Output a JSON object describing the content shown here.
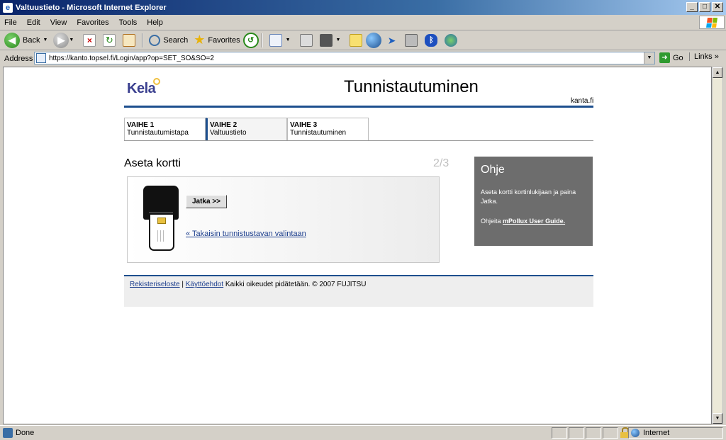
{
  "window": {
    "title": "Valtuustieto - Microsoft Internet Explorer",
    "buttons": {
      "minimize": "_",
      "maximize": "□",
      "close": "✕"
    }
  },
  "menu": {
    "items": [
      "File",
      "Edit",
      "View",
      "Favorites",
      "Tools",
      "Help"
    ]
  },
  "toolbar": {
    "back_label": "Back",
    "search_label": "Search",
    "favorites_label": "Favorites"
  },
  "address": {
    "label": "Address",
    "url": "https://kanto.topsel.fi/Login/app?op=SET_SO&SO=2",
    "go_label": "Go",
    "links_label": "Links"
  },
  "page": {
    "logo": "Kela",
    "title": "Tunnistautuminen",
    "site_link": "kanta.fi",
    "steps": [
      {
        "number": "VAIHE 1",
        "name": "Tunnistautumistapa"
      },
      {
        "number": "VAIHE 2",
        "name": "Valtuustieto"
      },
      {
        "number": "VAIHE 3",
        "name": "Tunnistautuminen"
      }
    ],
    "section_title": "Aseta kortti",
    "counter": "2/3",
    "continue_button": "Jatka >>",
    "back_link": "« Takaisin tunnistustavan valintaan",
    "help": {
      "title": "Ohje",
      "text": "Aseta kortti kortinlukijaan ja paina Jatka.",
      "link_prefix": "Ohjeita",
      "link_text": "mPollux User Guide."
    },
    "footer": {
      "link1": "Rekisteriseloste",
      "separator": "|",
      "link2": "Käyttöehdot",
      "copyright": "Kaikki oikeudet pidätetään. © 2007 FUJITSU"
    }
  },
  "status": {
    "text": "Done",
    "zone": "Internet"
  },
  "colors": {
    "accent": "#1d4f8e",
    "help_bg": "#6d6d6d",
    "logo": "#3a3f8f"
  }
}
